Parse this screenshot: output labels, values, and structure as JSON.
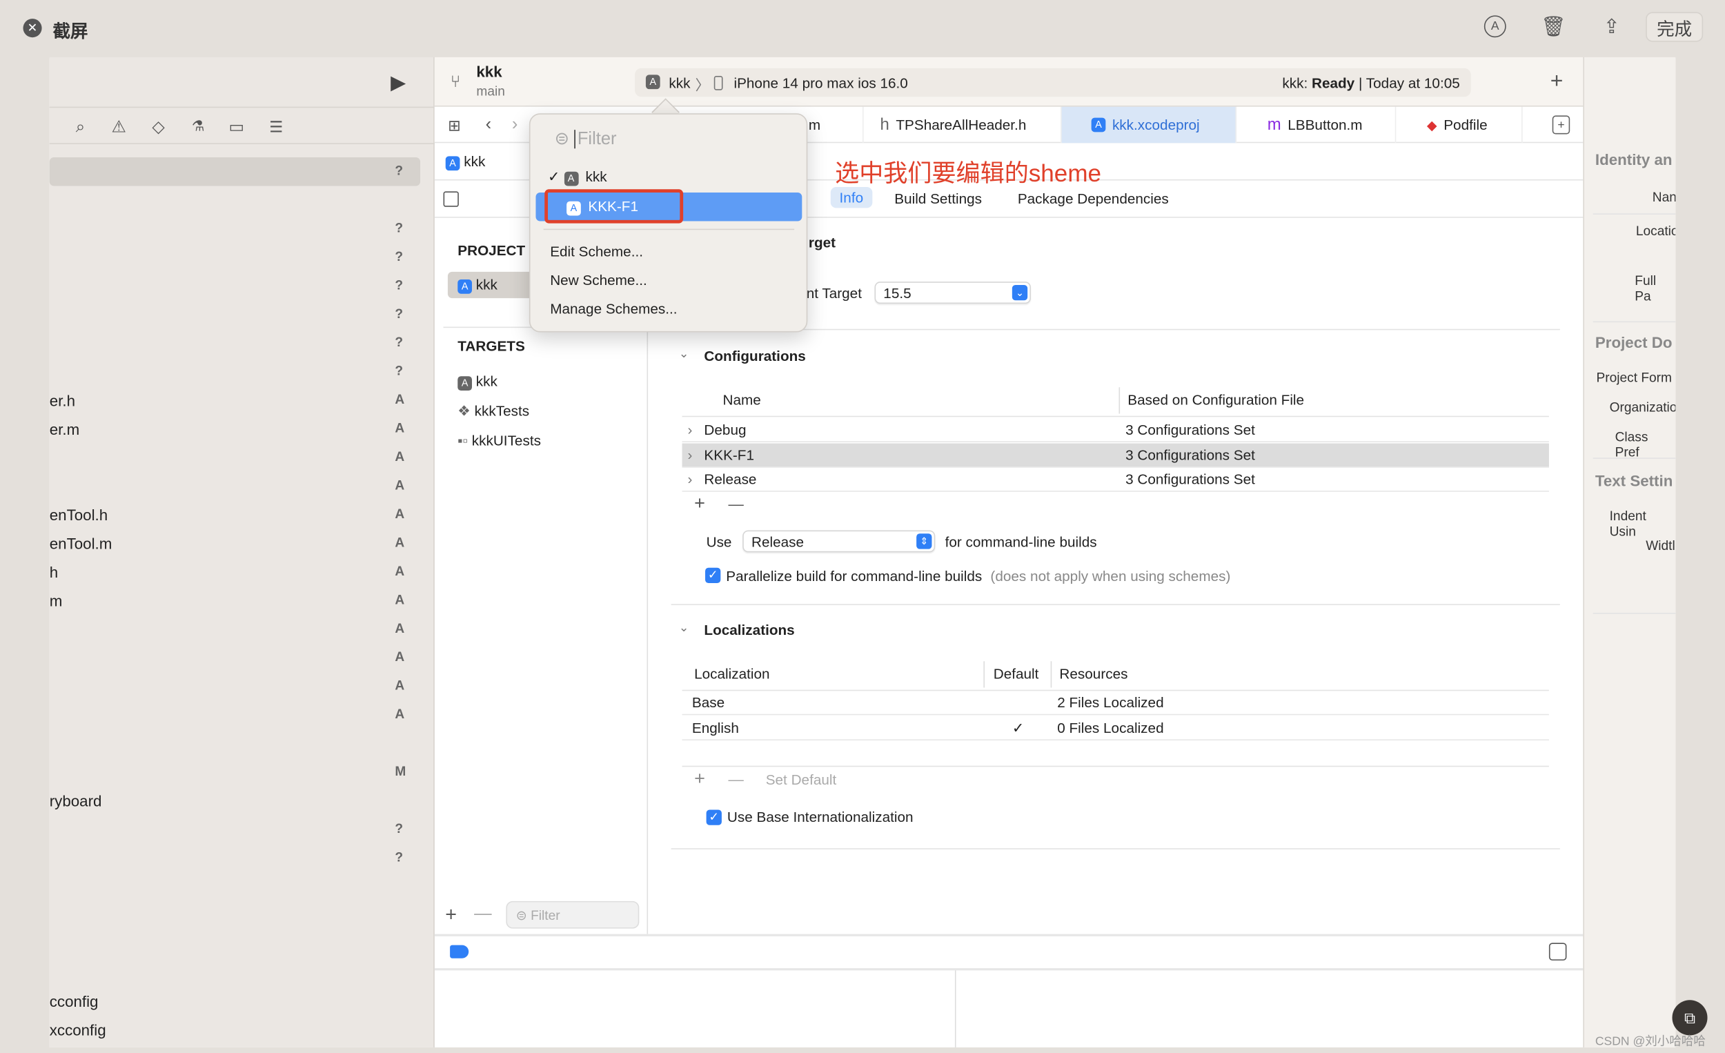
{
  "screenshot_bar": {
    "title": "截屏",
    "done_label": "完成",
    "icons": [
      "close-icon",
      "markup-icon",
      "trash-icon",
      "share-icon"
    ]
  },
  "toolbar": {
    "project": "kkk",
    "branch": "main",
    "scheme": "kkk",
    "device": "iPhone 14 pro max ios 16.0",
    "status_prefix": "kkk: ",
    "status": "Ready",
    "status_time": "| Today at 10:05"
  },
  "tabs": [
    {
      "label": "m",
      "icon": "m"
    },
    {
      "label": "TPShareAllHeader.h",
      "icon": "h"
    },
    {
      "label": "kkk.xcodeproj",
      "icon": "xcodeproj",
      "active": true
    },
    {
      "label": "LBButton.m",
      "icon": "m"
    },
    {
      "label": "Podfile",
      "icon": "ruby"
    }
  ],
  "breadcrumb": "kkk",
  "annotation": "选中我们要编辑的sheme",
  "editor_tabs": [
    "Info",
    "Build Settings",
    "Package Dependencies"
  ],
  "navigator": {
    "project_header": "PROJECT",
    "project_item": "kkk",
    "targets_header": "TARGETS",
    "targets": [
      "kkk",
      "kkkTests",
      "kkkUITests"
    ],
    "filter_placeholder": "Filter"
  },
  "sidebar": {
    "rows": [
      {
        "name": "",
        "status": "?"
      },
      {
        "name": "",
        "status": ""
      },
      {
        "name": "",
        "status": "?"
      },
      {
        "name": "",
        "status": "?"
      },
      {
        "name": "",
        "status": "?"
      },
      {
        "name": "",
        "status": "?"
      },
      {
        "name": "",
        "status": "?"
      },
      {
        "name": "",
        "status": "?"
      },
      {
        "name": "er.h",
        "status": "A"
      },
      {
        "name": "er.m",
        "status": "A"
      },
      {
        "name": "",
        "status": "A"
      },
      {
        "name": "",
        "status": "A"
      },
      {
        "name": "enTool.h",
        "status": "A"
      },
      {
        "name": "enTool.m",
        "status": "A"
      },
      {
        "name": "h",
        "status": "A"
      },
      {
        "name": "m",
        "status": "A"
      },
      {
        "name": "",
        "status": "A"
      },
      {
        "name": "",
        "status": "A"
      },
      {
        "name": "",
        "status": "A"
      },
      {
        "name": "",
        "status": "A"
      },
      {
        "name": "",
        "status": ""
      },
      {
        "name": "",
        "status": "M"
      },
      {
        "name": "ryboard",
        "status": ""
      },
      {
        "name": "",
        "status": "?"
      },
      {
        "name": "",
        "status": "?"
      },
      {
        "name": "",
        "status": ""
      },
      {
        "name": "",
        "status": ""
      },
      {
        "name": "",
        "status": ""
      },
      {
        "name": "",
        "status": ""
      },
      {
        "name": "cconfig",
        "status": ""
      },
      {
        "name": "xcconfig",
        "status": ""
      }
    ]
  },
  "info": {
    "deployment_heading": "rget",
    "deployment_label": "nt Target",
    "deployment_value": "15.5",
    "configurations": {
      "title": "Configurations",
      "columns": [
        "Name",
        "Based on Configuration File"
      ],
      "rows": [
        {
          "name": "Debug",
          "file": "3 Configurations Set"
        },
        {
          "name": "KKK-F1",
          "file": "3 Configurations Set",
          "selected": true
        },
        {
          "name": "Release",
          "file": "3 Configurations Set"
        }
      ],
      "use_label": "Use",
      "use_value": "Release",
      "use_suffix": "for command-line builds",
      "parallelize_label": "Parallelize build for command-line builds",
      "parallelize_note": "(does not apply when using schemes)",
      "parallelize_checked": true
    },
    "localizations": {
      "title": "Localizations",
      "columns": [
        "Localization",
        "Default",
        "Resources"
      ],
      "rows": [
        {
          "name": "Base",
          "default": "",
          "resources": "2 Files Localized"
        },
        {
          "name": "English",
          "default": "✓",
          "resources": "0 Files Localized"
        }
      ],
      "set_default": "Set Default",
      "use_base_label": "Use Base Internationalization",
      "use_base_checked": true
    }
  },
  "inspector": {
    "identity": "Identity an",
    "name": "Nan",
    "location": "Locatio",
    "full_path": "Full Pa",
    "project_doc": "Project Do",
    "project_format": "Project Form",
    "organization": "Organizatio",
    "class_prefix": "Class Pref",
    "text_settings": "Text Settin",
    "indent": "Indent Usin",
    "width": "Widtl"
  },
  "scheme_menu": {
    "filter_placeholder": "Filter",
    "schemes": [
      {
        "label": "kkk",
        "checked": true
      },
      {
        "label": "KKK-F1",
        "highlighted": true
      }
    ],
    "actions": [
      "Edit Scheme...",
      "New Scheme...",
      "Manage Schemes..."
    ]
  },
  "watermark": "CSDN @刘小哈哈哈",
  "colors": {
    "accent": "#2f7ff6",
    "highlight": "#5e9cf5",
    "annotation": "#e0402a",
    "selected_tab": "#d9e6f7"
  }
}
